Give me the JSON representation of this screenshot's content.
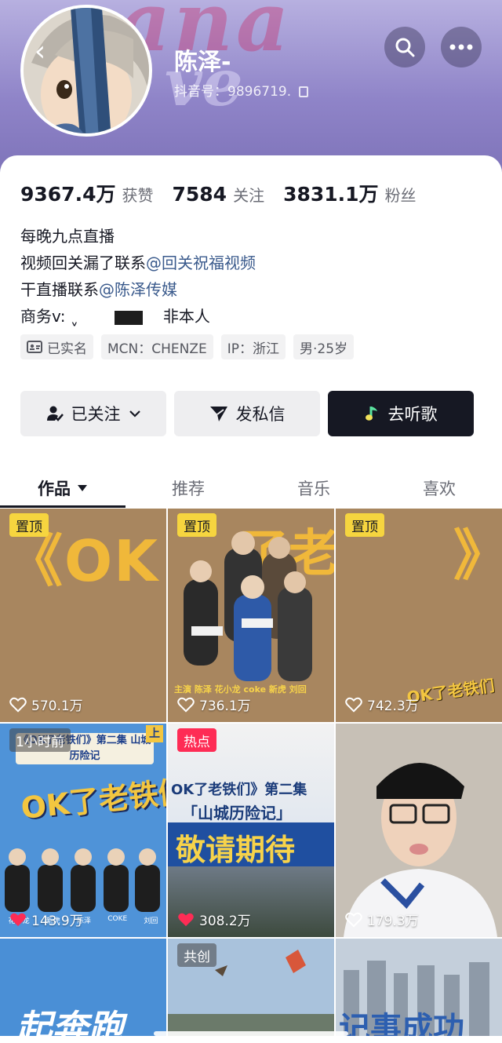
{
  "header": {
    "nickname": "陈泽-",
    "douyin_id": "抖音号：9896719.",
    "icons": {
      "back": "chevron-left-icon",
      "search": "search-icon",
      "more": "more-dots-icon"
    }
  },
  "stats": [
    {
      "value": "9367.4万",
      "label": "获赞"
    },
    {
      "value": "7584",
      "label": "关注"
    },
    {
      "value": "3831.1万",
      "label": "粉丝"
    }
  ],
  "bio": {
    "line1": "每晚九点直播",
    "line2_text": "视频回关漏了联系",
    "line2_mention": "@回关祝福视频",
    "line3_text": "干直播联系",
    "line3_mention": "@陈泽传媒",
    "line4_prefix": "商务v: ˬ",
    "line4_suffix": "非本人"
  },
  "tags": [
    {
      "icon": "id-card-icon",
      "label": "已实名"
    },
    {
      "label": "MCN：CHENZE"
    },
    {
      "label": "IP：浙江"
    },
    {
      "label": "男·25岁"
    }
  ],
  "actions": {
    "follow": "已关注",
    "message": "发私信",
    "music": "去听歌"
  },
  "tabs": [
    {
      "label": "作品",
      "active": true
    },
    {
      "label": "推荐"
    },
    {
      "label": "音乐"
    },
    {
      "label": "喜欢"
    }
  ],
  "videos": [
    {
      "badge": "置顶",
      "badge_type": "yellow",
      "likes": "570.1万",
      "liked": false,
      "art_text": "《OK"
    },
    {
      "badge": "置顶",
      "badge_type": "yellow",
      "likes": "736.1万",
      "liked": false,
      "art_text": "了老铁们",
      "caption": "主演 陈泽 花小龙 coke 新虎 刘回"
    },
    {
      "badge": "置顶",
      "badge_type": "yellow",
      "likes": "742.3万",
      "liked": false,
      "art_text": "》",
      "logo": "OK了老铁们"
    },
    {
      "badge": "1小时前",
      "badge_type": "grey",
      "likes": "143.9万",
      "liked": true,
      "art_text": "OK了老铁们",
      "headline": "《OK了老铁们》第二集 山城历险记",
      "corner": "上",
      "names": [
        "花小龙",
        "新虎",
        "陈泽",
        "COKE",
        "刘回"
      ]
    },
    {
      "badge": "热点",
      "badge_type": "red",
      "likes": "308.2万",
      "liked": true,
      "line1": "OK了老铁们》第二集",
      "line2": "「山城历险记」",
      "line3": "敬请期待"
    },
    {
      "likes": "179.3万",
      "liked": false
    },
    {
      "art_text": "起奔跑"
    },
    {
      "badge": "共创",
      "badge_type": "grey"
    },
    {
      "art_text": "记事成功"
    }
  ],
  "colors": {
    "header_purple": "#8f84c8",
    "mention_blue": "#3a5a8c",
    "pin_yellow": "#f6d53f",
    "hot_red": "#fe2c55",
    "dark_button": "#161823"
  }
}
